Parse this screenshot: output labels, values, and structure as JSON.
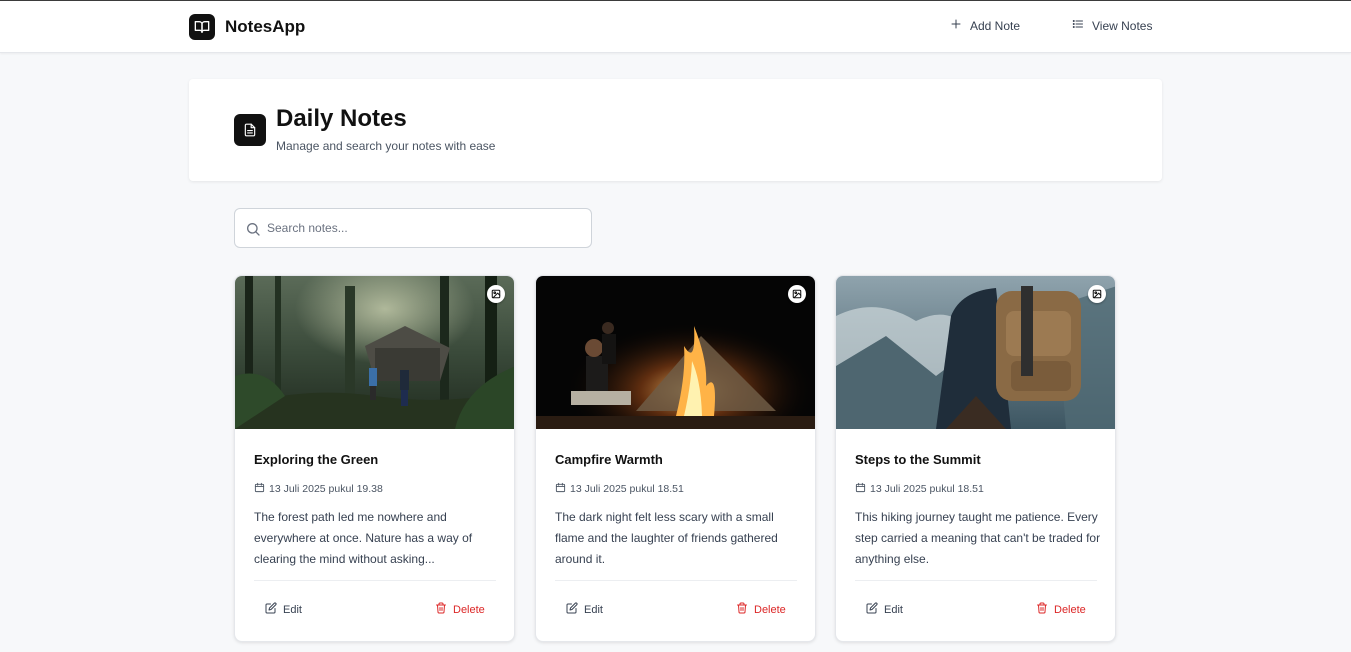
{
  "brand": {
    "name": "NotesApp",
    "logo_icon": "book-open-icon"
  },
  "nav": {
    "add_label": "Add Note",
    "view_label": "View Notes"
  },
  "header": {
    "title": "Daily Notes",
    "subtitle": "Manage and search your notes with ease"
  },
  "search": {
    "placeholder": "Search notes..."
  },
  "actions": {
    "edit_label": "Edit",
    "delete_label": "Delete"
  },
  "colors": {
    "accent": "#111111",
    "danger": "#dc2626",
    "background": "#f7f8fa"
  },
  "notes": [
    {
      "title": "Exploring the Green",
      "date": "13 Juli 2025 pukul 19.38",
      "body": "The forest path led me nowhere and everywhere at once. Nature has a way of clearing the mind without asking...",
      "image": "forest-photo"
    },
    {
      "title": "Campfire Warmth",
      "date": "13 Juli 2025 pukul 18.51",
      "body": "The dark night felt less scary with a small flame and the laughter of friends gathered around it.",
      "image": "campfire-photo"
    },
    {
      "title": "Steps to the Summit",
      "date": "13 Juli 2025 pukul 18.51",
      "body": "This hiking journey taught me patience. Every step carried a meaning that can't be traded for anything else.",
      "image": "hiker-photo"
    }
  ]
}
